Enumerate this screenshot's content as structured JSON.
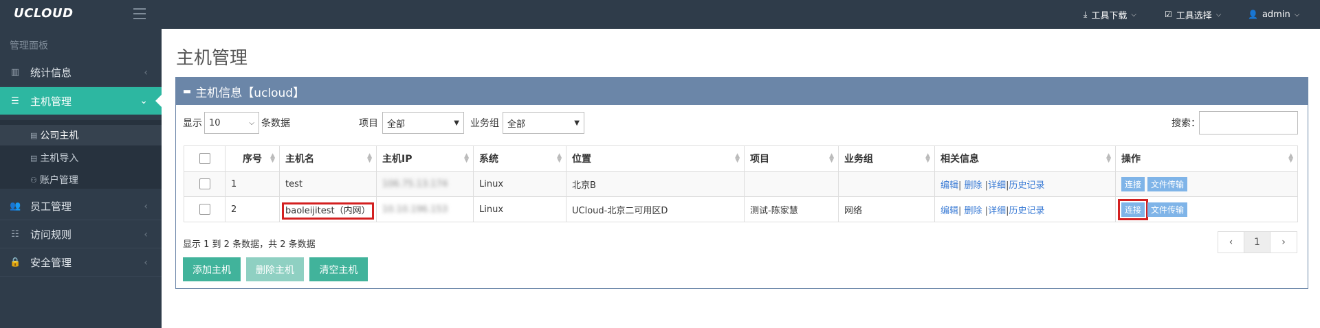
{
  "topbar": {
    "logo": "UCLOUD",
    "menu": [
      {
        "icon": "download-icon",
        "label": "工具下载"
      },
      {
        "icon": "check-square-icon",
        "label": "工具选择"
      },
      {
        "icon": "user-icon",
        "label": "admin"
      }
    ]
  },
  "sidebar": {
    "title": "管理面板",
    "items": [
      {
        "icon": "bar-chart-icon",
        "label": "统计信息"
      },
      {
        "icon": "server-icon",
        "label": "主机管理"
      },
      {
        "icon": "users-icon",
        "label": "员工管理"
      },
      {
        "icon": "list-icon",
        "label": "访问规则"
      },
      {
        "icon": "lock-icon",
        "label": "安全管理"
      }
    ],
    "subitems": [
      {
        "icon": "server-icon",
        "label": "公司主机"
      },
      {
        "icon": "server-icon",
        "label": "主机导入"
      },
      {
        "icon": "sitemap-icon",
        "label": "账户管理"
      }
    ]
  },
  "page": {
    "title": "主机管理",
    "panel_title": "主机信息【ucloud】"
  },
  "controls": {
    "show_label": "显示",
    "page_size": "10",
    "page_size_suffix": "条数据",
    "project_label": "项目",
    "project_value": "全部",
    "group_label": "业务组",
    "group_value": "全部",
    "search_label": "搜索："
  },
  "table": {
    "headers": [
      "序号",
      "主机名",
      "主机IP",
      "系统",
      "位置",
      "项目",
      "业务组",
      "相关信息",
      "操作"
    ],
    "rows": [
      {
        "no": "1",
        "name": "test",
        "ip": "106.75.13.174",
        "os": "Linux",
        "location": "北京B",
        "project": "",
        "group": ""
      },
      {
        "no": "2",
        "name": "baoleijitest（内网）",
        "ip": "10.10.196.153",
        "os": "Linux",
        "location": "UCloud-北京二可用区D",
        "project": "测试-陈家慧",
        "group": "网络"
      }
    ],
    "info_links": [
      "编辑",
      "删除",
      "详细",
      "历史记录"
    ],
    "actions": [
      "连接",
      "文件传输"
    ]
  },
  "footer": {
    "summary": "显示 1 到 2 条数据，共 2 条数据",
    "buttons": [
      "添加主机",
      "删除主机",
      "清空主机"
    ],
    "pager": [
      "‹",
      "1",
      "›"
    ]
  }
}
